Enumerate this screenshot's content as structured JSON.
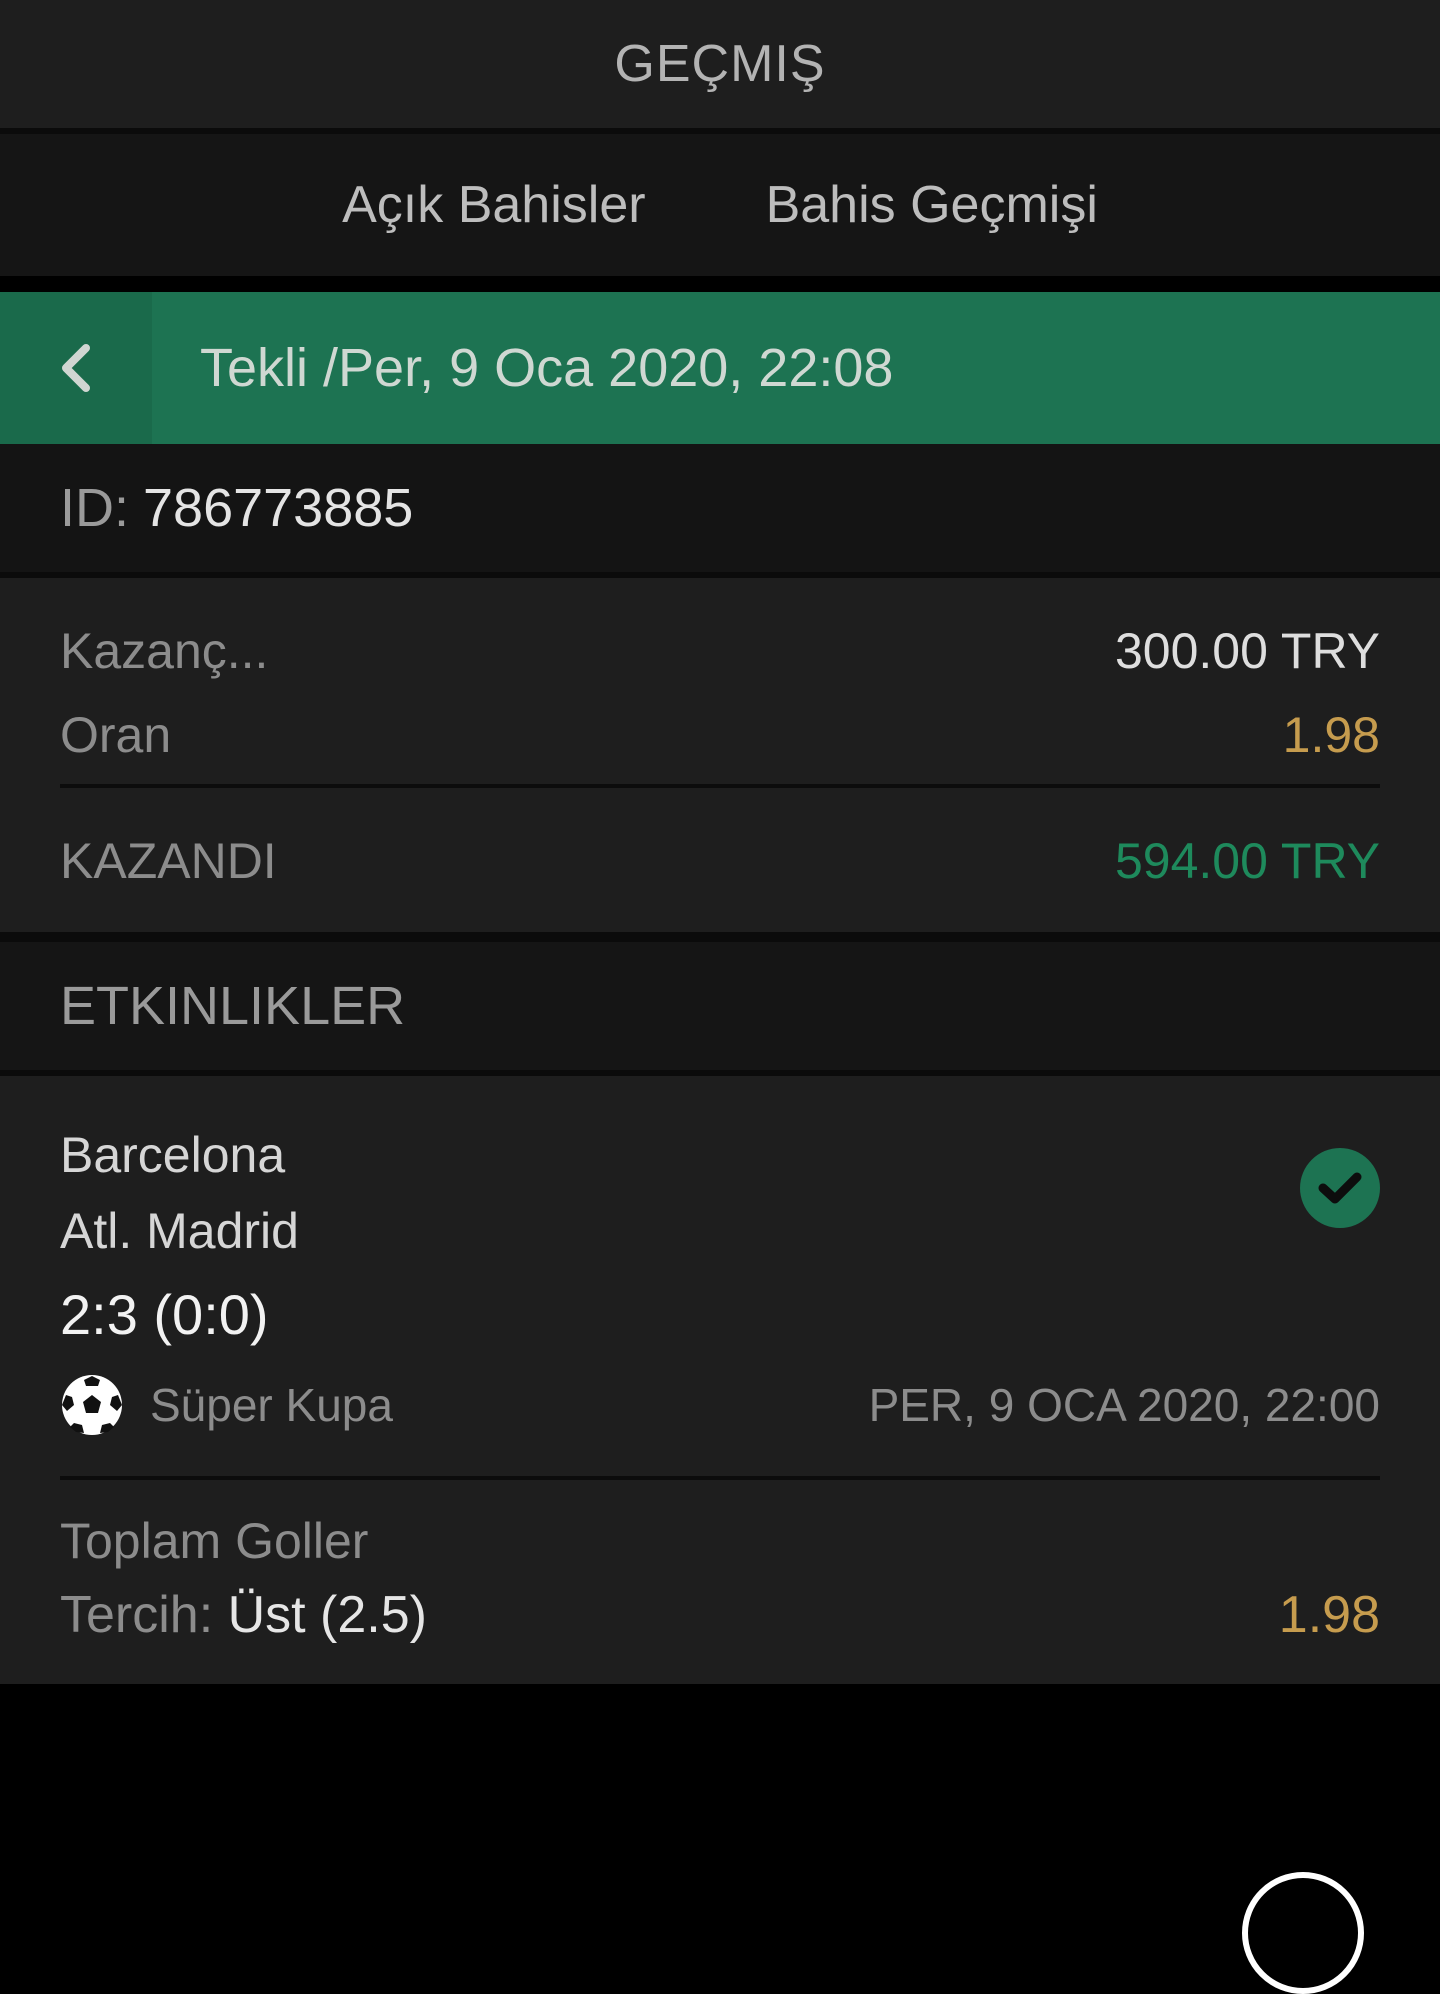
{
  "header": {
    "title": "GEÇMIŞ"
  },
  "tabs": [
    {
      "label": "Açık Bahisler"
    },
    {
      "label": "Bahis Geçmişi"
    }
  ],
  "bet": {
    "title": "Tekli /Per, 9 Oca 2020, 22:08",
    "id_label": "ID:",
    "id_value": "786773885",
    "stake_label": "Kazanç...",
    "stake_value": "300.00 TRY",
    "odds_label": "Oran",
    "odds_value": "1.98",
    "result_label": "KAZANDI",
    "result_value": "594.00 TRY"
  },
  "events": {
    "header": "ETKINLIKLER",
    "item": {
      "home": "Barcelona",
      "away": "Atl. Madrid",
      "score": "2:3 (0:0)",
      "league": "Süper Kupa",
      "date": "PER, 9 OCA 2020, 22:00",
      "market": "Toplam Goller",
      "selection_label": "Tercih:",
      "selection_value": "Üst (2.5)",
      "odds": "1.98",
      "status_icon": "check-circle-icon",
      "sport_icon": "soccer-ball-icon"
    }
  },
  "colors": {
    "accent_green": "#1d7352",
    "win_green": "#1e8a5c",
    "odds_gold": "#c69c4e"
  }
}
